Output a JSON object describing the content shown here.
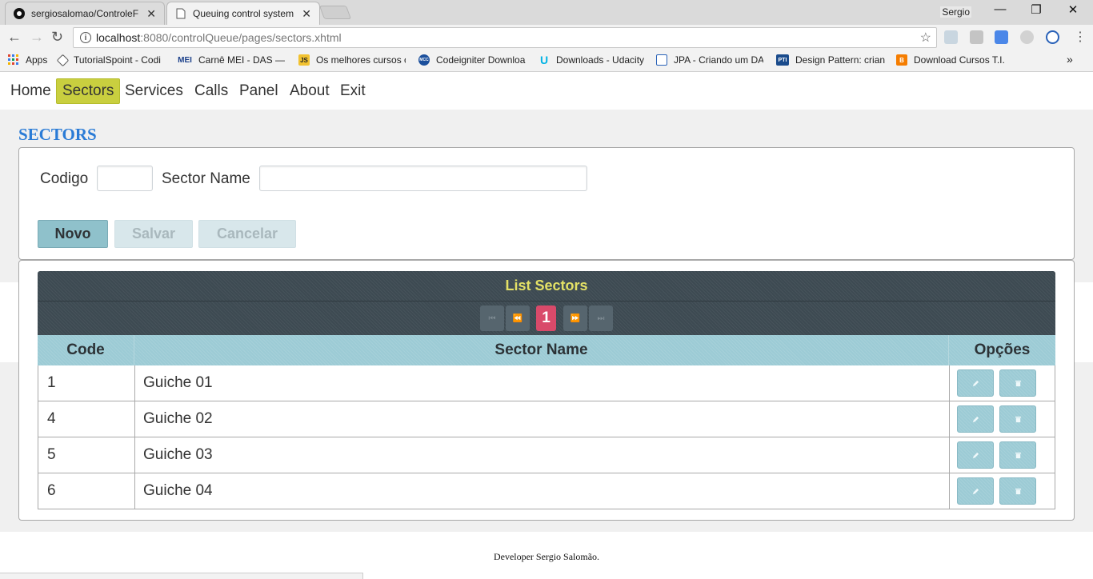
{
  "browser": {
    "tabs": [
      {
        "label": "sergiosalomao/ControleF",
        "close": "✕"
      },
      {
        "label": "Queuing control system",
        "close": "✕"
      }
    ],
    "user": "Sergio",
    "window_controls": {
      "minimize": "—",
      "maximize": "❐",
      "close": "✕"
    },
    "url_host": "localhost",
    "url_path": ":8080/controlQueue/pages/sectors.xhtml",
    "bookmarks": [
      "Apps",
      "TutorialSpoint - Codi",
      "Carnê MEI - DAS — P",
      "Os melhores cursos o",
      "Codeigniter Downloa",
      "Downloads - Udacity",
      "JPA - Criando um DAO",
      "Design Pattern: crianc",
      "Download Cursos T.I."
    ],
    "bookmark_icon_text": {
      "mei": "MEI",
      "js": "JS",
      "pti": "PTI",
      "mcc": "MCC"
    },
    "more": "»"
  },
  "menu": {
    "items": [
      "Home",
      "Sectors",
      "Services",
      "Calls",
      "Panel",
      "About",
      "Exit"
    ],
    "active": "Sectors",
    "active_color": "#c9cf3f"
  },
  "page": {
    "title": "SECTORS",
    "title_color": "#2a7bd6"
  },
  "form": {
    "code_label": "Codigo",
    "code_value": "",
    "name_label": "Sector Name",
    "name_value": "",
    "buttons": {
      "new": "Novo",
      "save": "Salvar",
      "cancel": "Cancelar"
    }
  },
  "table": {
    "title": "List Sectors",
    "title_color": "#e4e166",
    "paginator": {
      "current_page": "1"
    },
    "columns": [
      "Code",
      "Sector Name",
      "Opções"
    ],
    "rows": [
      {
        "code": "1",
        "name": "Guiche 01"
      },
      {
        "code": "4",
        "name": "Guiche 02"
      },
      {
        "code": "5",
        "name": "Guiche 03"
      },
      {
        "code": "6",
        "name": "Guiche 04"
      }
    ],
    "row_actions": [
      "edit-icon",
      "trash-icon"
    ]
  },
  "footer": {
    "text": "Developer Sergio Salomão."
  }
}
